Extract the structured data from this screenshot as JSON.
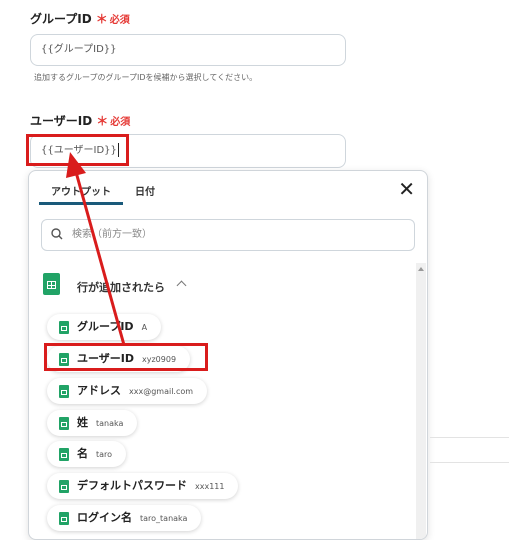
{
  "group_field": {
    "label": "グループID",
    "required_star": "＊",
    "required_text": "必須",
    "value": "{{グループID}}",
    "helper": "追加するグループのグループIDを候補から選択してください。"
  },
  "user_field": {
    "label": "ユーザーID",
    "required_star": "＊",
    "required_text": "必須",
    "value": "{{ユーザーID}}"
  },
  "panel": {
    "tabs": [
      "アウトプット",
      "日付"
    ],
    "close_label": "✕",
    "search_placeholder": "検索（前方一致）",
    "section_title": "行が追加されたら",
    "items": [
      {
        "label": "グループID",
        "value": "A"
      },
      {
        "label": "ユーザーID",
        "value": "xyz0909"
      },
      {
        "label": "アドレス",
        "value": "xxx@gmail.com"
      },
      {
        "label": "姓",
        "value": "tanaka"
      },
      {
        "label": "名",
        "value": "taro"
      },
      {
        "label": "デフォルトパスワード",
        "value": "xxx111"
      },
      {
        "label": "ログイン名",
        "value": "taro_tanaka"
      }
    ]
  },
  "colors": {
    "accent_red": "#d91c1c",
    "required": "#e53935",
    "sheets_green": "#21a366",
    "tab_underline": "#1a5a7a"
  }
}
